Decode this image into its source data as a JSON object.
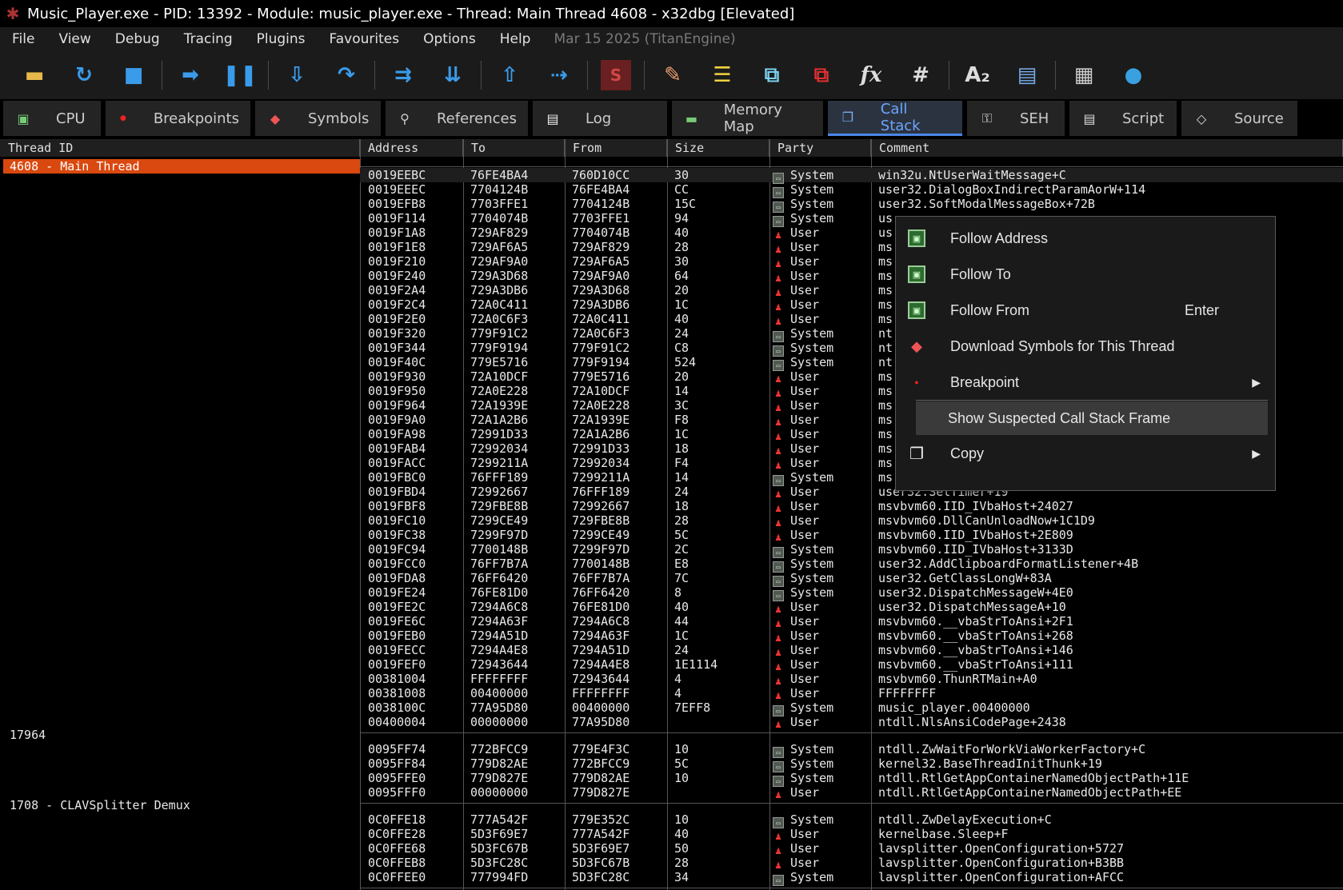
{
  "window": {
    "title": "Music_Player.exe - PID: 13392 - Module: music_player.exe - Thread: Main Thread 4608 - x32dbg [Elevated]"
  },
  "menu": {
    "items": [
      "File",
      "View",
      "Debug",
      "Tracing",
      "Plugins",
      "Favourites",
      "Options",
      "Help"
    ],
    "info": "Mar 15 2025 (TitanEngine)"
  },
  "toolbar": {
    "buttons": [
      {
        "name": "open-icon",
        "glyph": "▬",
        "color": "#e8b84a"
      },
      {
        "name": "restart-icon",
        "glyph": "↻",
        "color": "#3a9bea"
      },
      {
        "name": "stop-icon",
        "glyph": "■",
        "color": "#3a9bea"
      },
      {
        "sep": true
      },
      {
        "name": "run-icon",
        "glyph": "➡",
        "color": "#3a9bea"
      },
      {
        "name": "pause-icon",
        "glyph": "❚❚",
        "color": "#3a9bea"
      },
      {
        "sep": true
      },
      {
        "name": "step-into-icon",
        "glyph": "⇩",
        "color": "#3a9bea"
      },
      {
        "name": "step-over-icon",
        "glyph": "↷",
        "color": "#3a9bea"
      },
      {
        "sep": true
      },
      {
        "name": "trace-into-icon",
        "glyph": "⇉",
        "color": "#3a9bea"
      },
      {
        "name": "trace-over-icon",
        "glyph": "⇊",
        "color": "#3a9bea"
      },
      {
        "sep": true
      },
      {
        "name": "execute-till-return-icon",
        "glyph": "⇧",
        "color": "#3a9bea"
      },
      {
        "name": "run-to-user-code-icon",
        "glyph": "⇢",
        "color": "#3a9bea"
      },
      {
        "sep": true
      },
      {
        "name": "scylla-icon",
        "glyph": "S",
        "color": "#d04848"
      },
      {
        "sep": true
      },
      {
        "name": "patch-icon",
        "glyph": "✎",
        "color": "#f0a070"
      },
      {
        "name": "comments-icon",
        "glyph": "☰",
        "color": "#f0d040"
      },
      {
        "name": "labels-icon",
        "glyph": "⧉",
        "color": "#7ad0f0"
      },
      {
        "name": "bookmarks-icon",
        "glyph": "⧉",
        "color": "#e03030"
      },
      {
        "name": "functions-icon",
        "glyph": "fx",
        "color": "#dddddd"
      },
      {
        "name": "hash-icon",
        "glyph": "#",
        "color": "#dddddd"
      },
      {
        "sep": true
      },
      {
        "name": "strings-icon",
        "glyph": "A₂",
        "color": "#dddddd"
      },
      {
        "name": "calls-icon",
        "glyph": "▤",
        "color": "#7ab0f0"
      },
      {
        "sep": true
      },
      {
        "name": "calculator-icon",
        "glyph": "▦",
        "color": "#cccccc"
      },
      {
        "name": "globe-icon",
        "glyph": "●",
        "color": "#3aa0e0"
      }
    ]
  },
  "tabs": [
    {
      "label": "CPU",
      "icon": "cpu-icon",
      "glyph": "▣",
      "color": "#7c7"
    },
    {
      "label": "Breakpoints",
      "icon": "breakpoint-icon",
      "glyph": "●",
      "color": "#e22"
    },
    {
      "label": "Symbols",
      "icon": "symbols-icon",
      "glyph": "◆",
      "color": "#e55"
    },
    {
      "label": "References",
      "icon": "references-icon",
      "glyph": "⚲",
      "color": "#ccc"
    },
    {
      "label": "Log",
      "icon": "log-icon",
      "glyph": "▤",
      "color": "#eee"
    },
    {
      "label": "Memory Map",
      "icon": "memory-map-icon",
      "glyph": "▬",
      "color": "#7c7"
    },
    {
      "label": "Call Stack",
      "icon": "call-stack-icon",
      "glyph": "❐",
      "color": "#7ab0f0",
      "active": true
    },
    {
      "label": "SEH",
      "icon": "seh-icon",
      "glyph": "⚿",
      "color": "#ddd"
    },
    {
      "label": "Script",
      "icon": "script-icon",
      "glyph": "▤",
      "color": "#ddd"
    },
    {
      "label": "Source",
      "icon": "source-icon",
      "glyph": "◇",
      "color": "#ddd"
    }
  ],
  "columns": [
    "Thread ID",
    "Address",
    "To",
    "From",
    "Size",
    "Party",
    "Comment"
  ],
  "threads": [
    {
      "label": "4608 - Main Thread",
      "selected": true
    },
    {
      "label": "17964"
    },
    {
      "label": "1708 - CLAVSplitter Demux"
    }
  ],
  "groups": [
    {
      "rows": [
        [
          "0019EEBC",
          "76FE4BA4",
          "760D10CC",
          "30",
          "System",
          "win32u.NtUserWaitMessage+C"
        ],
        [
          "0019EEEC",
          "7704124B",
          "76FE4BA4",
          "CC",
          "System",
          "user32.DialogBoxIndirectParamAorW+114"
        ],
        [
          "0019EFB8",
          "7703FFE1",
          "7704124B",
          "15C",
          "System",
          "user32.SoftModalMessageBox+72B"
        ],
        [
          "0019F114",
          "7704074B",
          "7703FFE1",
          "94",
          "System",
          "us"
        ],
        [
          "0019F1A8",
          "729AF829",
          "7704074B",
          "40",
          "User",
          "us"
        ],
        [
          "0019F1E8",
          "729AF6A5",
          "729AF829",
          "28",
          "User",
          "ms"
        ],
        [
          "0019F210",
          "729AF9A0",
          "729AF6A5",
          "30",
          "User",
          "ms"
        ],
        [
          "0019F240",
          "729A3D68",
          "729AF9A0",
          "64",
          "User",
          "ms"
        ],
        [
          "0019F2A4",
          "729A3DB6",
          "729A3D68",
          "20",
          "User",
          "ms"
        ],
        [
          "0019F2C4",
          "72A0C411",
          "729A3DB6",
          "1C",
          "User",
          "ms"
        ],
        [
          "0019F2E0",
          "72A0C6F3",
          "72A0C411",
          "40",
          "User",
          "ms"
        ],
        [
          "0019F320",
          "779F91C2",
          "72A0C6F3",
          "24",
          "System",
          "nt"
        ],
        [
          "0019F344",
          "779F9194",
          "779F91C2",
          "C8",
          "System",
          "nt"
        ],
        [
          "0019F40C",
          "779E5716",
          "779F9194",
          "524",
          "System",
          "nt"
        ],
        [
          "0019F930",
          "72A10DCF",
          "779E5716",
          "20",
          "User",
          "ms"
        ],
        [
          "0019F950",
          "72A0E228",
          "72A10DCF",
          "14",
          "User",
          "ms"
        ],
        [
          "0019F964",
          "72A1939E",
          "72A0E228",
          "3C",
          "User",
          "ms"
        ],
        [
          "0019F9A0",
          "72A1A2B6",
          "72A1939E",
          "F8",
          "User",
          "ms"
        ],
        [
          "0019FA98",
          "72991D33",
          "72A1A2B6",
          "1C",
          "User",
          "ms"
        ],
        [
          "0019FAB4",
          "72992034",
          "72991D33",
          "18",
          "User",
          "ms"
        ],
        [
          "0019FACC",
          "7299211A",
          "72992034",
          "F4",
          "User",
          "ms"
        ],
        [
          "0019FBC0",
          "76FFF189",
          "7299211A",
          "14",
          "System",
          "ms"
        ],
        [
          "0019FBD4",
          "72992667",
          "76FFF189",
          "24",
          "User",
          "user32.SetTimer+19"
        ],
        [
          "0019FBF8",
          "729FBE8B",
          "72992667",
          "18",
          "User",
          "msvbvm60.IID_IVbaHost+24027"
        ],
        [
          "0019FC10",
          "7299CE49",
          "729FBE8B",
          "28",
          "User",
          "msvbvm60.DllCanUnloadNow+1C1D9"
        ],
        [
          "0019FC38",
          "7299F97D",
          "7299CE49",
          "5C",
          "User",
          "msvbvm60.IID_IVbaHost+2E809"
        ],
        [
          "0019FC94",
          "7700148B",
          "7299F97D",
          "2C",
          "System",
          "msvbvm60.IID_IVbaHost+3133D"
        ],
        [
          "0019FCC0",
          "76FF7B7A",
          "7700148B",
          "E8",
          "System",
          "user32.AddClipboardFormatListener+4B"
        ],
        [
          "0019FDA8",
          "76FF6420",
          "76FF7B7A",
          "7C",
          "System",
          "user32.GetClassLongW+83A"
        ],
        [
          "0019FE24",
          "76FE81D0",
          "76FF6420",
          "8",
          "System",
          "user32.DispatchMessageW+4E0"
        ],
        [
          "0019FE2C",
          "7294A6C8",
          "76FE81D0",
          "40",
          "User",
          "user32.DispatchMessageA+10"
        ],
        [
          "0019FE6C",
          "7294A63F",
          "7294A6C8",
          "44",
          "User",
          "msvbvm60.__vbaStrToAnsi+2F1"
        ],
        [
          "0019FEB0",
          "7294A51D",
          "7294A63F",
          "1C",
          "User",
          "msvbvm60.__vbaStrToAnsi+268"
        ],
        [
          "0019FECC",
          "7294A4E8",
          "7294A51D",
          "24",
          "User",
          "msvbvm60.__vbaStrToAnsi+146"
        ],
        [
          "0019FEF0",
          "72943644",
          "7294A4E8",
          "1E1114",
          "User",
          "msvbvm60.__vbaStrToAnsi+111"
        ],
        [
          "00381004",
          "FFFFFFFF",
          "72943644",
          "4",
          "User",
          "msvbvm60.ThunRTMain+A0"
        ],
        [
          "00381008",
          "00400000",
          "FFFFFFFF",
          "4",
          "User",
          "FFFFFFFF"
        ],
        [
          "0038100C",
          "77A95D80",
          "00400000",
          "7EFF8",
          "System",
          "music_player.00400000"
        ],
        [
          "00400004",
          "00000000",
          "77A95D80",
          "",
          "User",
          "ntdll.NlsAnsiCodePage+2438"
        ]
      ]
    },
    {
      "rows": [
        [
          "0095FF74",
          "772BFCC9",
          "779E4F3C",
          "10",
          "System",
          "ntdll.ZwWaitForWorkViaWorkerFactory+C"
        ],
        [
          "0095FF84",
          "779D82AE",
          "772BFCC9",
          "5C",
          "System",
          "kernel32.BaseThreadInitThunk+19"
        ],
        [
          "0095FFE0",
          "779D827E",
          "779D82AE",
          "10",
          "System",
          "ntdll.RtlGetAppContainerNamedObjectPath+11E"
        ],
        [
          "0095FFF0",
          "00000000",
          "779D827E",
          "",
          "User",
          "ntdll.RtlGetAppContainerNamedObjectPath+EE"
        ]
      ]
    },
    {
      "rows": [
        [
          "0C0FFE18",
          "777A542F",
          "779E352C",
          "10",
          "System",
          "ntdll.ZwDelayExecution+C"
        ],
        [
          "0C0FFE28",
          "5D3F69E7",
          "777A542F",
          "40",
          "User",
          "kernelbase.Sleep+F"
        ],
        [
          "0C0FFE68",
          "5D3FC67B",
          "5D3F69E7",
          "50",
          "User",
          "lavsplitter.OpenConfiguration+5727"
        ],
        [
          "0C0FFEB8",
          "5D3FC28C",
          "5D3FC67B",
          "28",
          "User",
          "lavsplitter.OpenConfiguration+B3BB"
        ],
        [
          "0C0FFEE0",
          "777994FD",
          "5D3FC28C",
          "34",
          "System",
          "lavsplitter.OpenConfiguration+AFCC"
        ]
      ]
    }
  ],
  "context_menu": {
    "items": [
      {
        "label": "Follow Address",
        "icon": "follow-address-icon",
        "type": "green"
      },
      {
        "label": "Follow To",
        "icon": "follow-to-icon",
        "type": "green"
      },
      {
        "label": "Follow From",
        "icon": "follow-from-icon",
        "type": "green",
        "shortcut": "Enter"
      },
      {
        "label": "Download Symbols for This Thread",
        "icon": "download-symbols-icon",
        "type": "symbols"
      },
      {
        "label": "Breakpoint",
        "icon": "breakpoint-icon",
        "type": "bp",
        "submenu": true
      },
      {
        "label": "Show Suspected Call Stack Frame",
        "icon": "",
        "type": "none",
        "hover": true
      },
      {
        "label": "Copy",
        "icon": "copy-icon",
        "type": "copy",
        "submenu": true
      }
    ]
  }
}
